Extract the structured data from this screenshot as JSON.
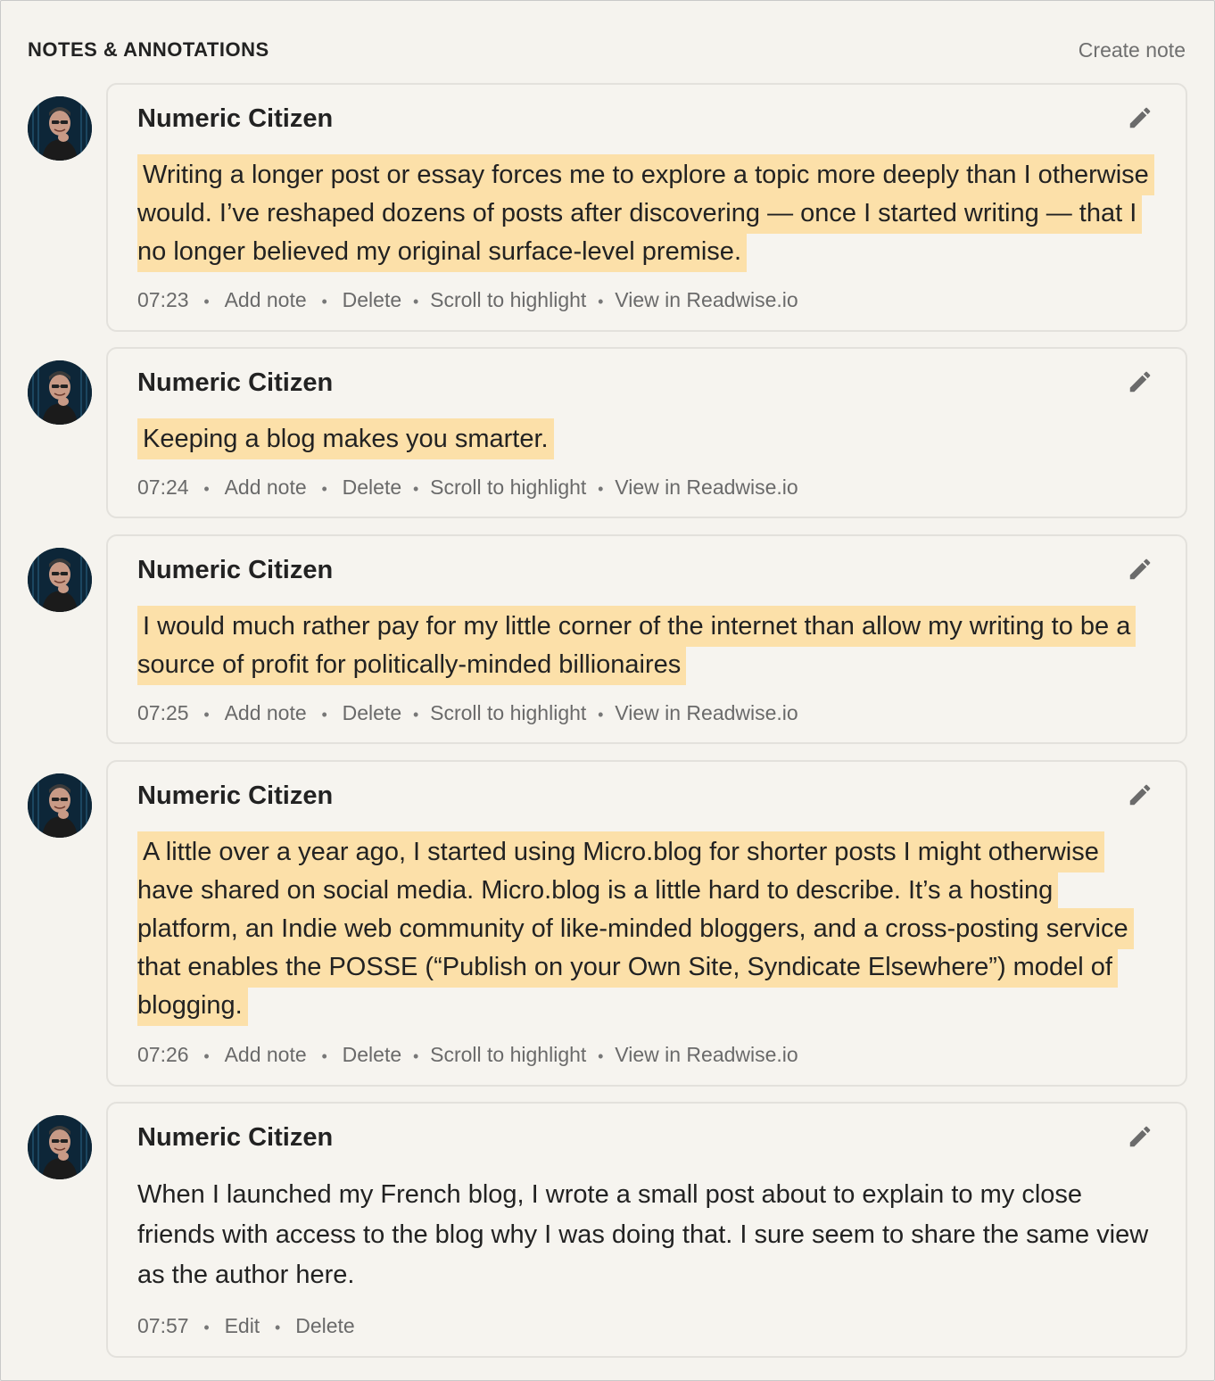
{
  "header": {
    "title": "NOTES & ANNOTATIONS",
    "create_note": "Create note"
  },
  "icons": {
    "edit": "pencil-icon",
    "avatar": "user-avatar"
  },
  "colors": {
    "highlight": "#fce0a9",
    "background": "#f5f3ee",
    "card_border": "#e3e1dc"
  },
  "entries": [
    {
      "author": "Numeric Citizen",
      "type": "highlight",
      "text": "Writing a longer post or essay forces me to explore a topic more deeply than I otherwise would. I’ve reshaped dozens of posts after discovering — once I started writing — that I no longer believed my original surface-level premise.",
      "time": "07:23",
      "actions": [
        "Add note",
        "Delete",
        "Scroll to highlight",
        "View in Readwise.io"
      ]
    },
    {
      "author": "Numeric Citizen",
      "type": "highlight",
      "text": "Keeping a blog makes you smarter.",
      "time": "07:24",
      "actions": [
        "Add note",
        "Delete",
        "Scroll to highlight",
        "View in Readwise.io"
      ]
    },
    {
      "author": "Numeric Citizen",
      "type": "highlight",
      "text": "I would much rather pay for my little corner of the internet than allow my writing to be a source of profit for politically-minded billionaires",
      "time": "07:25",
      "actions": [
        "Add note",
        "Delete",
        "Scroll to highlight",
        "View in Readwise.io"
      ]
    },
    {
      "author": "Numeric Citizen",
      "type": "highlight",
      "text": "A little over a year ago, I started using Micro.blog for shorter posts I might otherwise have shared on social media. Micro.blog is a little hard to describe. It’s a hosting platform, an Indie web community of like-minded bloggers, and a cross-posting service that enables the POSSE (“Publish on your Own Site, Syndicate Elsewhere”) model of blogging.",
      "time": "07:26",
      "actions": [
        "Add note",
        "Delete",
        "Scroll to highlight",
        "View in Readwise.io"
      ]
    },
    {
      "author": "Numeric Citizen",
      "type": "note",
      "text": "When I launched my French blog, I wrote a small post about to explain to my close friends with access to the blog why I was doing that. I sure seem to share the same view as the author here.",
      "time": "07:57",
      "actions": [
        "Edit",
        "Delete"
      ]
    }
  ]
}
